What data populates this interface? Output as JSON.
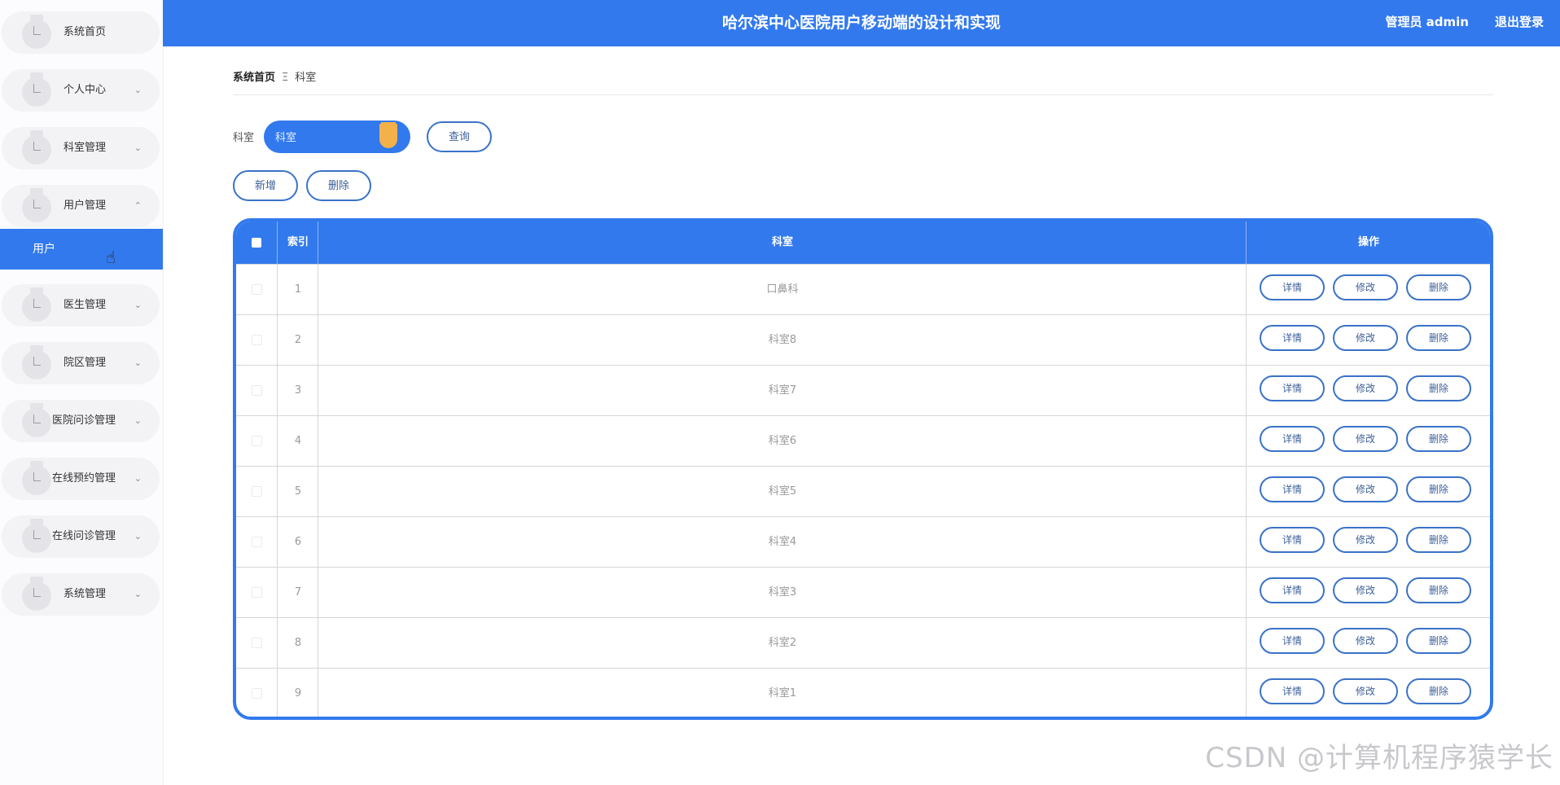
{
  "header": {
    "title": "哈尔滨中心医院用户移动端的设计和实现",
    "user": "管理员 admin",
    "logout": "退出登录"
  },
  "sidebar": {
    "items": [
      {
        "label": "系统首页",
        "chevron": ""
      },
      {
        "label": "个人中心",
        "chevron": "⌄"
      },
      {
        "label": "科室管理",
        "chevron": "⌄"
      },
      {
        "label": "用户管理",
        "chevron": "⌃"
      },
      {
        "label": "医生管理",
        "chevron": "⌄"
      },
      {
        "label": "院区管理",
        "chevron": "⌄"
      },
      {
        "label": "医院问诊管理",
        "chevron": "⌄"
      },
      {
        "label": "在线预约管理",
        "chevron": "⌄"
      },
      {
        "label": "在线问诊管理",
        "chevron": "⌄"
      },
      {
        "label": "系统管理",
        "chevron": "⌄"
      }
    ],
    "sub_item": "用户",
    "cursor_icon": "hand-pointer-icon"
  },
  "breadcrumb": {
    "home": "系统首页",
    "sep": "Ξ",
    "current": "科室"
  },
  "search": {
    "label": "科室",
    "placeholder": "科室",
    "query_button": "查询"
  },
  "actions": {
    "add": "新增",
    "delete": "删除"
  },
  "table": {
    "headers": {
      "index": "索引",
      "name": "科室",
      "ops": "操作"
    },
    "rows": [
      {
        "index": "1",
        "name": "口鼻科"
      },
      {
        "index": "2",
        "name": "科室8"
      },
      {
        "index": "3",
        "name": "科室7"
      },
      {
        "index": "4",
        "name": "科室6"
      },
      {
        "index": "5",
        "name": "科室5"
      },
      {
        "index": "6",
        "name": "科室4"
      },
      {
        "index": "7",
        "name": "科室3"
      },
      {
        "index": "8",
        "name": "科室2"
      },
      {
        "index": "9",
        "name": "科室1"
      }
    ],
    "row_actions": {
      "detail": "详情",
      "edit": "修改",
      "delete": "删除"
    }
  },
  "watermark": "CSDN @计算机程序猿学长",
  "colors": {
    "primary": "#3279ed",
    "accent": "#f4b14a",
    "button_border": "#3a72c8"
  }
}
